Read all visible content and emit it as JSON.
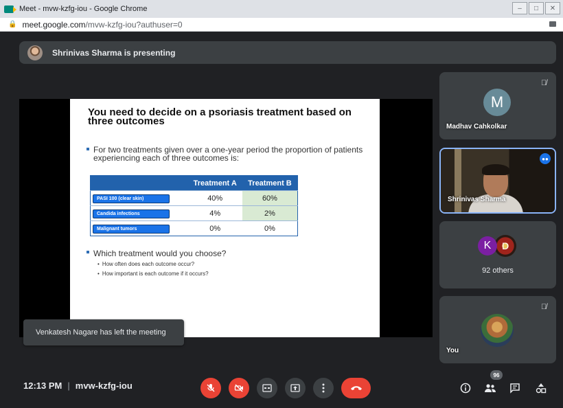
{
  "window": {
    "title": "Meet - mvw-kzfg-iou - Google Chrome",
    "url_host": "meet.google.com",
    "url_path": "/mvw-kzfg-iou?authuser=0",
    "controls": [
      "–",
      "□",
      "✕"
    ]
  },
  "presenter_banner": {
    "text": "Shrinivas Sharma is presenting"
  },
  "slide": {
    "headline": "You need to decide on a psoriasis treatment based on three outcomes",
    "bullet1": "For two treatments given over a one-year period the proportion of patients experiencing each of three outcomes is:",
    "table": {
      "headers": [
        "",
        "Treatment A",
        "Treatment B"
      ],
      "rows": [
        {
          "label": "PASI 100 (clear skin)",
          "a": "40%",
          "b": "60%"
        },
        {
          "label": "Candida infections",
          "a": "4%",
          "b": "2%"
        },
        {
          "label": "Malignant tumors",
          "a": "0%",
          "b": "0%"
        }
      ]
    },
    "bullet2": "Which treatment would you choose?",
    "sub1": "How often does each outcome occur?",
    "sub2": "How important is each outcome if it occurs?"
  },
  "toast": {
    "text": "Venkatesh Nagare has left the meeting"
  },
  "participants": {
    "tile1": {
      "initial": "M",
      "name": "Madhav Cahkolkar"
    },
    "tile2": {
      "name": "Shrinivas Sharma"
    },
    "tile3": {
      "initial_k": "K",
      "initial_d": "D",
      "others": "92 others"
    },
    "tile4": {
      "name": "You"
    }
  },
  "bottom_bar": {
    "time": "12:13 PM",
    "separator": "|",
    "meeting_code": "mvw-kzfg-iou",
    "people_count": "96"
  },
  "colors": {
    "background": "#202124",
    "tile": "#3c4043",
    "danger": "#ea4335",
    "accent": "#1a73e8",
    "table_header": "#2262ac"
  }
}
